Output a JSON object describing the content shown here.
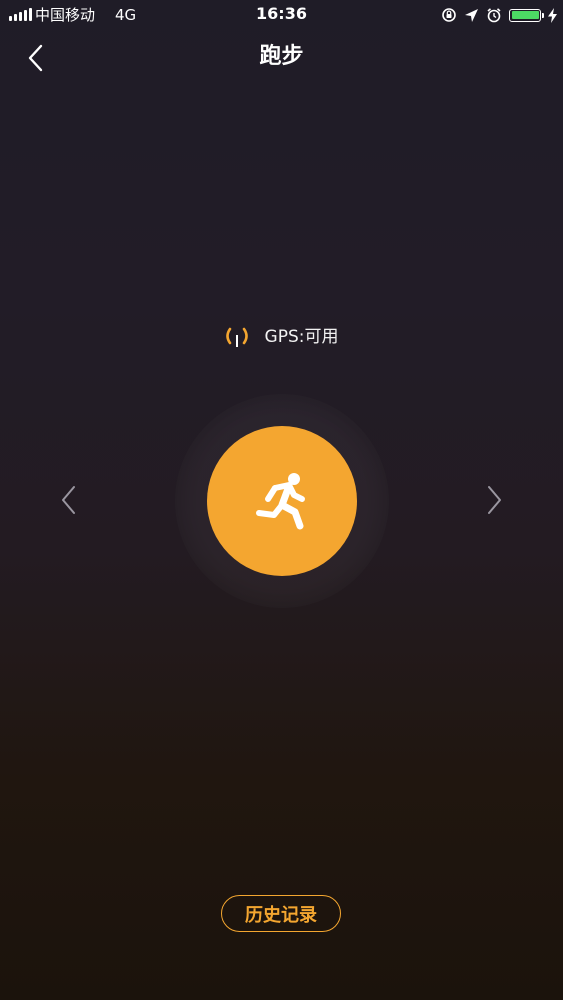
{
  "status_bar": {
    "carrier": "中国移动",
    "network": "4G",
    "time": "16:36",
    "battery_color": "#4cd964"
  },
  "nav": {
    "title": "跑步",
    "back_icon": "chevron-left-icon"
  },
  "gps": {
    "label": "GPS:可用",
    "icon": "gps-signal-icon",
    "icon_color": "#f4a630"
  },
  "start": {
    "icon": "running-person-icon",
    "color": "#f4a630"
  },
  "carousel": {
    "prev_icon": "chevron-left-icon",
    "next_icon": "chevron-right-icon"
  },
  "history_button": {
    "label": "历史记录",
    "color": "#f4a630"
  }
}
